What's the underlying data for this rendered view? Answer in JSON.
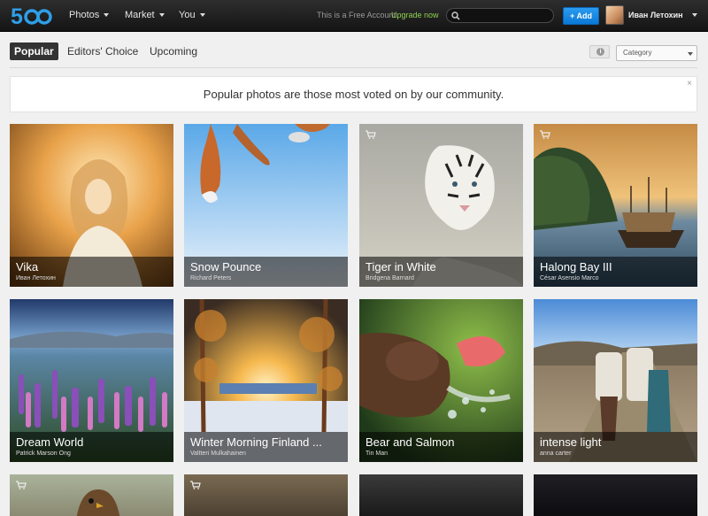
{
  "header": {
    "logo": "500",
    "nav": [
      {
        "label": "Photos"
      },
      {
        "label": "Market"
      },
      {
        "label": "You"
      }
    ],
    "free_account_text": "This is a Free Account.",
    "upgrade_link": "Upgrade now",
    "search_placeholder": "",
    "add_button": "+ Add",
    "username": "Иван Летохин"
  },
  "tabs": [
    {
      "label": "Popular",
      "active": true
    },
    {
      "label": "Editors' Choice"
    },
    {
      "label": "Upcoming"
    }
  ],
  "category_select": {
    "selected": "Category"
  },
  "notice": {
    "text": "Popular photos are those most voted on by our community.",
    "close": "×"
  },
  "photos": [
    {
      "title": "Vika",
      "author": "Иван Летохин",
      "cart": false
    },
    {
      "title": "Snow Pounce",
      "author": "Richard Peters",
      "cart": false
    },
    {
      "title": "Tiger in White",
      "author": "Bridgena Barnard",
      "cart": true
    },
    {
      "title": "Halong Bay III",
      "author": "César Asensio Marco",
      "cart": true
    },
    {
      "title": "Dream World",
      "author": "Patrick Marson Ong",
      "cart": false
    },
    {
      "title": "Winter Morning Finland ...",
      "author": "Valtteri Mulkahainen",
      "cart": false
    },
    {
      "title": "Bear and Salmon",
      "author": "Tin Man",
      "cart": false
    },
    {
      "title": "intense light",
      "author": "anna carter",
      "cart": false
    }
  ],
  "colors": {
    "topbar": "#1c1c1c",
    "accent_blue": "#1a8be6",
    "upgrade_green": "#8fd14f"
  }
}
